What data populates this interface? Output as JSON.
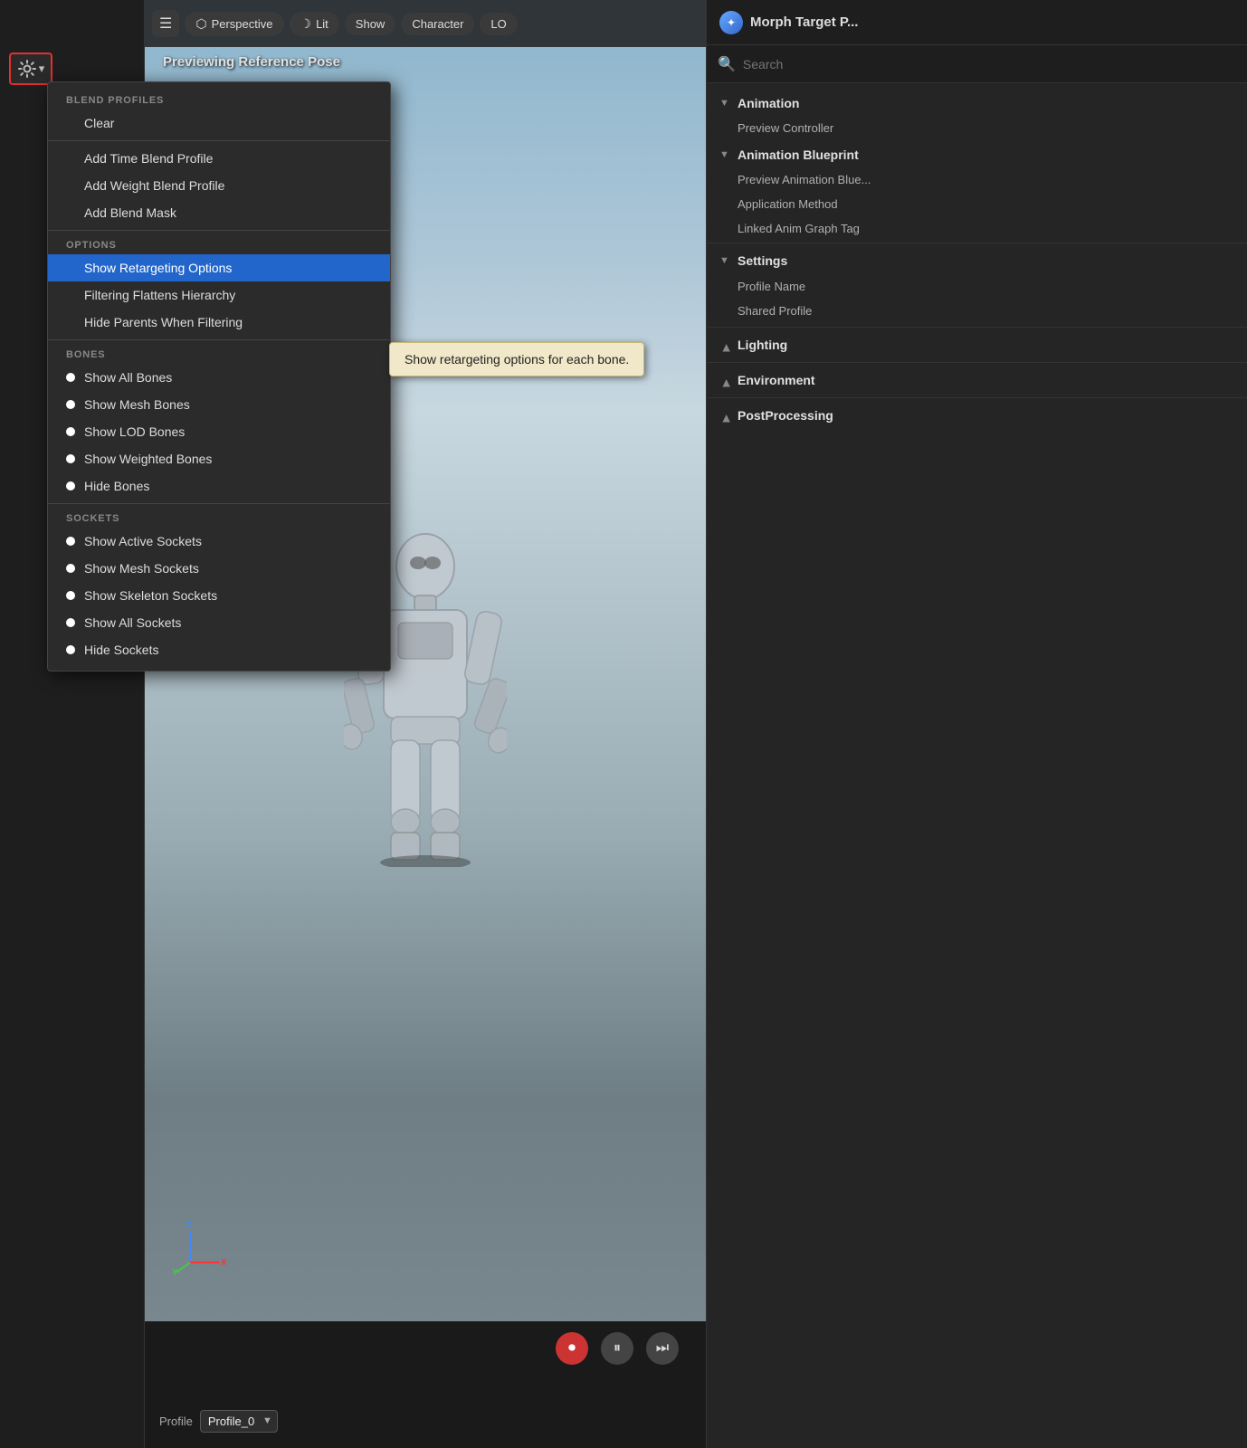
{
  "window_title": "Morph Target P...",
  "viewport": {
    "label": "Previewing Reference Pose",
    "toolbar_buttons": [
      {
        "id": "menu-btn",
        "label": "☰",
        "icon": "menu"
      },
      {
        "id": "perspective-btn",
        "label": "Perspective",
        "icon": "cube"
      },
      {
        "id": "lit-btn",
        "label": "Lit",
        "icon": "moon"
      },
      {
        "id": "show-btn",
        "label": "Show"
      },
      {
        "id": "character-btn",
        "label": "Character"
      },
      {
        "id": "lod-btn",
        "label": "LO"
      }
    ],
    "bottom_profile_label": "Profile",
    "bottom_profile_value": "Profile_0"
  },
  "dropdown": {
    "sections": [
      {
        "id": "blend-profiles",
        "header": "BLEND PROFILES",
        "items": [
          {
            "id": "clear",
            "label": "Clear",
            "bullet": false,
            "active": false
          },
          {
            "id": "separator1",
            "type": "divider"
          },
          {
            "id": "add-time",
            "label": "Add Time Blend Profile",
            "bullet": false,
            "active": false
          },
          {
            "id": "add-weight",
            "label": "Add Weight Blend Profile",
            "bullet": false,
            "active": false
          },
          {
            "id": "add-mask",
            "label": "Add Blend Mask",
            "bullet": false,
            "active": false
          }
        ]
      },
      {
        "id": "options",
        "header": "OPTIONS",
        "items": [
          {
            "id": "show-retargeting",
            "label": "Show Retargeting Options",
            "bullet": false,
            "active": true
          },
          {
            "id": "filtering-flattens",
            "label": "Filtering Flattens Hierarchy",
            "bullet": false,
            "active": false
          },
          {
            "id": "hide-parents",
            "label": "Hide Parents When Filtering",
            "bullet": false,
            "active": false
          }
        ]
      },
      {
        "id": "bones",
        "header": "BONES",
        "items": [
          {
            "id": "show-all-bones",
            "label": "Show All Bones",
            "bullet": true,
            "active": false
          },
          {
            "id": "show-mesh-bones",
            "label": "Show Mesh Bones",
            "bullet": true,
            "active": false
          },
          {
            "id": "show-lod-bones",
            "label": "Show LOD Bones",
            "bullet": true,
            "active": false
          },
          {
            "id": "show-weighted-bones",
            "label": "Show Weighted Bones",
            "bullet": true,
            "active": false
          },
          {
            "id": "hide-bones",
            "label": "Hide Bones",
            "bullet": true,
            "active": false
          }
        ]
      },
      {
        "id": "sockets",
        "header": "SOCKETS",
        "items": [
          {
            "id": "show-active-sockets",
            "label": "Show Active Sockets",
            "bullet": true,
            "active": false
          },
          {
            "id": "show-mesh-sockets",
            "label": "Show Mesh Sockets",
            "bullet": true,
            "active": false
          },
          {
            "id": "show-skeleton-sockets",
            "label": "Show Skeleton Sockets",
            "bullet": true,
            "active": false
          },
          {
            "id": "show-all-sockets",
            "label": "Show All Sockets",
            "bullet": true,
            "active": false
          },
          {
            "id": "hide-sockets",
            "label": "Hide Sockets",
            "bullet": true,
            "active": false
          }
        ]
      }
    ]
  },
  "tooltip": {
    "text": "Show retargeting options for each bone."
  },
  "right_panel": {
    "title": "Morph Target P...",
    "search_placeholder": "Search",
    "tree": [
      {
        "id": "animation",
        "label": "Animation",
        "expanded": true,
        "children": [
          {
            "id": "preview-controller",
            "label": "Preview Controller"
          }
        ]
      },
      {
        "id": "animation-blueprint",
        "label": "Animation Blueprint",
        "expanded": true,
        "children": [
          {
            "id": "preview-animation-blue",
            "label": "Preview Animation Blue..."
          },
          {
            "id": "application-method",
            "label": "Application Method"
          },
          {
            "id": "linked-anim-graph-tag",
            "label": "Linked Anim Graph Tag"
          }
        ]
      }
    ],
    "settings_section": {
      "label": "Settings",
      "expanded": true,
      "props": [
        {
          "id": "profile-name",
          "label": "Profile Name"
        },
        {
          "id": "shared-profile",
          "label": "Shared Profile"
        }
      ]
    },
    "subsections": [
      {
        "id": "lighting",
        "label": "Lighting",
        "expanded": false
      },
      {
        "id": "environment",
        "label": "Environment",
        "expanded": false
      },
      {
        "id": "post-processing",
        "label": "PostProcessing",
        "expanded": false
      }
    ]
  },
  "colors": {
    "active_blue": "#2266cc",
    "accent_red": "#e03030",
    "bg_dark": "#1a1a1a",
    "bg_panel": "#252525",
    "text_light": "#dddddd",
    "text_muted": "#888888"
  }
}
